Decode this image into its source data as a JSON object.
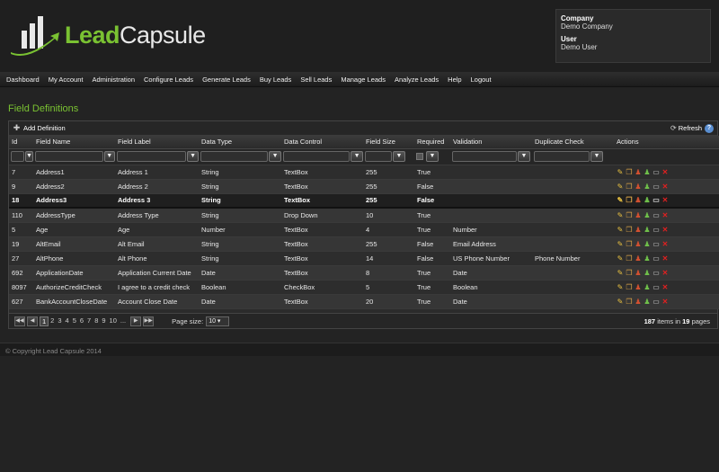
{
  "brand": {
    "lead": "Lead",
    "capsule": "Capsule"
  },
  "account": {
    "company_label": "Company",
    "company": "Demo Company",
    "user_label": "User",
    "user": "Demo User"
  },
  "nav": [
    "Dashboard",
    "My Account",
    "Administration",
    "Configure Leads",
    "Generate Leads",
    "Buy Leads",
    "Sell Leads",
    "Manage Leads",
    "Analyze Leads",
    "Help",
    "Logout"
  ],
  "page_title": "Field Definitions",
  "toolbar": {
    "add_label": "Add Definition",
    "refresh_label": "Refresh",
    "help": "?"
  },
  "columns": [
    "Id",
    "Field Name",
    "Field Label",
    "Data Type",
    "Data Control",
    "Field Size",
    "Required",
    "Validation",
    "Duplicate Check",
    "Actions"
  ],
  "rows": [
    {
      "id": "7",
      "name": "Address1",
      "label": "Address 1",
      "type": "String",
      "control": "TextBox",
      "size": "255",
      "required": "True",
      "validation": "",
      "dup": ""
    },
    {
      "id": "9",
      "name": "Address2",
      "label": "Address 2",
      "type": "String",
      "control": "TextBox",
      "size": "255",
      "required": "False",
      "validation": "",
      "dup": ""
    },
    {
      "id": "18",
      "name": "Address3",
      "label": "Address 3",
      "type": "String",
      "control": "TextBox",
      "size": "255",
      "required": "False",
      "validation": "",
      "dup": ""
    },
    {
      "id": "110",
      "name": "AddressType",
      "label": "Address Type",
      "type": "String",
      "control": "Drop Down",
      "size": "10",
      "required": "True",
      "validation": "",
      "dup": ""
    },
    {
      "id": "5",
      "name": "Age",
      "label": "Age",
      "type": "Number",
      "control": "TextBox",
      "size": "4",
      "required": "True",
      "validation": "Number",
      "dup": ""
    },
    {
      "id": "19",
      "name": "AltEmail",
      "label": "Alt Email",
      "type": "String",
      "control": "TextBox",
      "size": "255",
      "required": "False",
      "validation": "Email Address",
      "dup": ""
    },
    {
      "id": "27",
      "name": "AltPhone",
      "label": "Alt Phone",
      "type": "String",
      "control": "TextBox",
      "size": "14",
      "required": "False",
      "validation": "US Phone Number",
      "dup": "Phone Number"
    },
    {
      "id": "692",
      "name": "ApplicationDate",
      "label": "Application Current Date",
      "type": "Date",
      "control": "TextBox",
      "size": "8",
      "required": "True",
      "validation": "Date",
      "dup": ""
    },
    {
      "id": "8097",
      "name": "AuthorizeCreditCheck",
      "label": "I agree to a credit check",
      "type": "Boolean",
      "control": "CheckBox",
      "size": "5",
      "required": "True",
      "validation": "Boolean",
      "dup": ""
    },
    {
      "id": "627",
      "name": "BankAccountCloseDate",
      "label": "Account Close Date",
      "type": "Date",
      "control": "TextBox",
      "size": "20",
      "required": "True",
      "validation": "Date",
      "dup": ""
    }
  ],
  "selected_row_index": 2,
  "pager": {
    "pages": [
      "1",
      "2",
      "3",
      "4",
      "5",
      "6",
      "7",
      "8",
      "9",
      "10",
      "..."
    ],
    "current": "1",
    "page_size_label": "Page size:",
    "page_size": "10",
    "items": "187",
    "items_text": "items in",
    "page_count": "19",
    "pages_text": "pages"
  },
  "footer": "© Copyright Lead Capsule 2014",
  "colors": {
    "accent": "#7ac232",
    "background": "#232323"
  }
}
